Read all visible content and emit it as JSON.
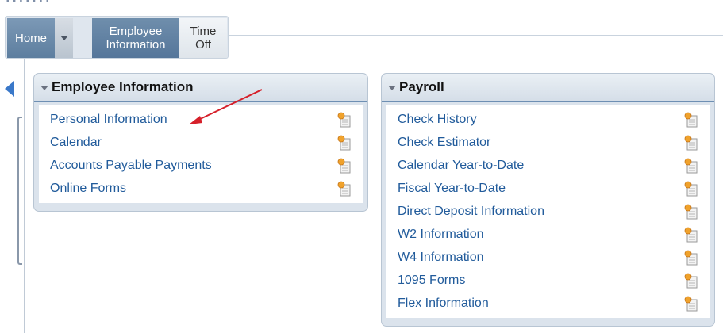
{
  "nav": {
    "home_label": "Home",
    "employee_info_label": "Employee Information",
    "time_off_label": "Time Off"
  },
  "employee_portlet": {
    "title": "Employee Information",
    "links": [
      {
        "label": "Personal Information"
      },
      {
        "label": "Calendar"
      },
      {
        "label": "Accounts Payable Payments"
      },
      {
        "label": "Online Forms"
      }
    ]
  },
  "payroll_portlet": {
    "title": "Payroll",
    "links": [
      {
        "label": "Check History"
      },
      {
        "label": "Check Estimator"
      },
      {
        "label": "Calendar Year-to-Date"
      },
      {
        "label": "Fiscal Year-to-Date"
      },
      {
        "label": "Direct Deposit Information"
      },
      {
        "label": "W2 Information"
      },
      {
        "label": "W4 Information"
      },
      {
        "label": "1095 Forms"
      },
      {
        "label": "Flex Information"
      }
    ]
  },
  "colors": {
    "link": "#215b9b",
    "nav_active": "#5d7e9f",
    "annotation_arrow": "#d6202a",
    "left_arrow": "#3a78c9"
  },
  "icons": {
    "row_action": "document-open-icon",
    "left_nav": "triangle-left-icon"
  }
}
